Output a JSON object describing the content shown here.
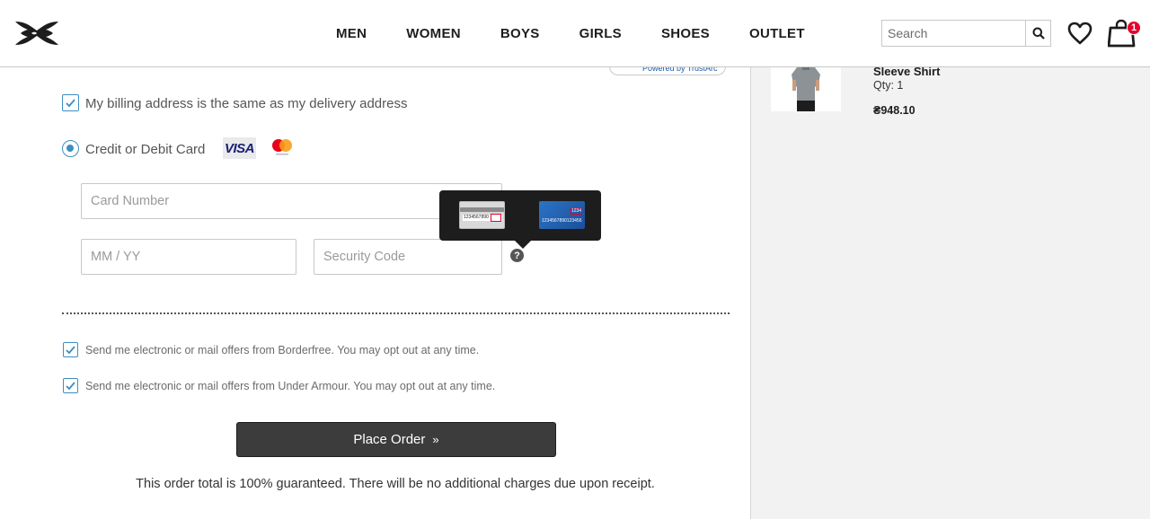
{
  "header": {
    "nav": [
      "MEN",
      "WOMEN",
      "BOYS",
      "GIRLS",
      "SHOES",
      "OUTLET"
    ],
    "search_placeholder": "Search",
    "bag_count": "1"
  },
  "trust_badge": "Powered by TrustArc",
  "billing": {
    "same_as_delivery_label": "My billing address is the same as my delivery address"
  },
  "payment": {
    "method_label": "Credit or Debit Card",
    "visa_label": "VISA",
    "card_number_placeholder": "Card Number",
    "expiry_placeholder": "MM / YY",
    "security_code_placeholder": "Security Code",
    "help_symbol": "?"
  },
  "tooltip": {
    "card_back_number": "1234567890",
    "card_back_code": "123",
    "card_front_code": "1234",
    "card_front_number": "1234567890123456"
  },
  "offers": {
    "borderfree_label": "Send me electronic or mail offers from Borderfree. You may opt out at any time.",
    "under_armour_label": "Send me electronic or mail offers from Under Armour. You may opt out at any time."
  },
  "place_order": {
    "label": "Place Order",
    "chevron": "»"
  },
  "guarantee_text": "This order total is 100% guaranteed. There will be no additional charges due upon receipt.",
  "summary": {
    "product_name": "Sleeve Shirt",
    "qty": "Qty: 1",
    "price": "₴948.10"
  },
  "colors": {
    "accent_blue": "#3c8fc2",
    "button_dark": "#3c3c3c",
    "badge_red": "#e4002b",
    "summary_bg": "#f2f2f2"
  }
}
